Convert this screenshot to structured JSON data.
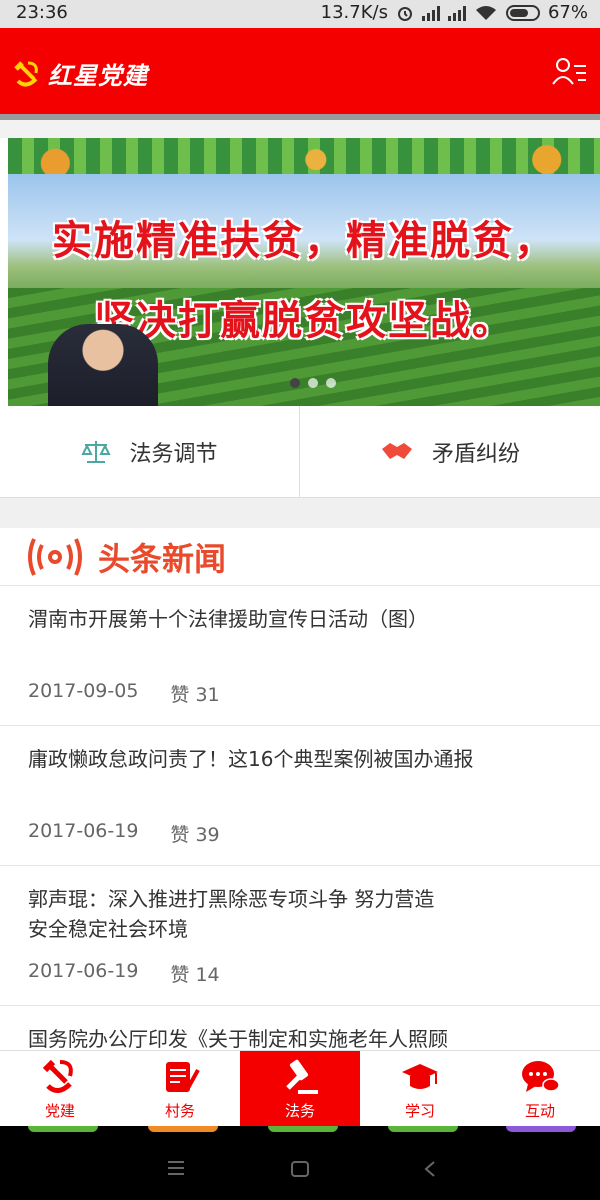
{
  "status_bar": {
    "time": "23:36",
    "net_speed": "13.7K/s",
    "battery": "67%"
  },
  "app_bar": {
    "title": "红星党建",
    "icons": [
      "party-emblem-icon",
      "user-menu-icon"
    ]
  },
  "banner": {
    "slogan_line1": "实施精准扶贫，精准脱贫，",
    "slogan_line2": "坚决打赢脱贫攻坚战。",
    "carousel_active_index": 0,
    "carousel_count": 3
  },
  "quick_links": [
    {
      "label": "法务调节",
      "icon": "scales-icon",
      "color": "#4aa8a0"
    },
    {
      "label": "矛盾纠纷",
      "icon": "handshake-icon",
      "color": "#ef4a3a"
    }
  ],
  "news": {
    "header": "头条新闻",
    "items": [
      {
        "title": "渭南市开展第十个法律援助宣传日活动（图）",
        "date": "2017-09-05",
        "likes": "赞 31"
      },
      {
        "title": "庸政懒政怠政问责了！这16个典型案例被国办通报",
        "date": "2017-06-19",
        "likes": "赞 39"
      },
      {
        "title_line1": "郭声琨：深入推进打黑除恶专项斗争 努力营造",
        "title_line2": "安全稳定社会环境",
        "date": "2017-06-19",
        "likes": "赞 14"
      },
      {
        "title": "国务院办公厅印发《关于制定和实施老年人照顾"
      }
    ]
  },
  "tabs": [
    {
      "label": "党建",
      "icon": "hammer-sickle-icon",
      "active": false
    },
    {
      "label": "村务",
      "icon": "notepad-icon",
      "active": false
    },
    {
      "label": "法务",
      "icon": "gavel-icon",
      "active": true
    },
    {
      "label": "学习",
      "icon": "graduation-cap-icon",
      "active": false
    },
    {
      "label": "互动",
      "icon": "chat-bubble-icon",
      "active": false
    }
  ],
  "colors": {
    "brand_red": "#f40000",
    "news_red": "#e94a2c"
  }
}
